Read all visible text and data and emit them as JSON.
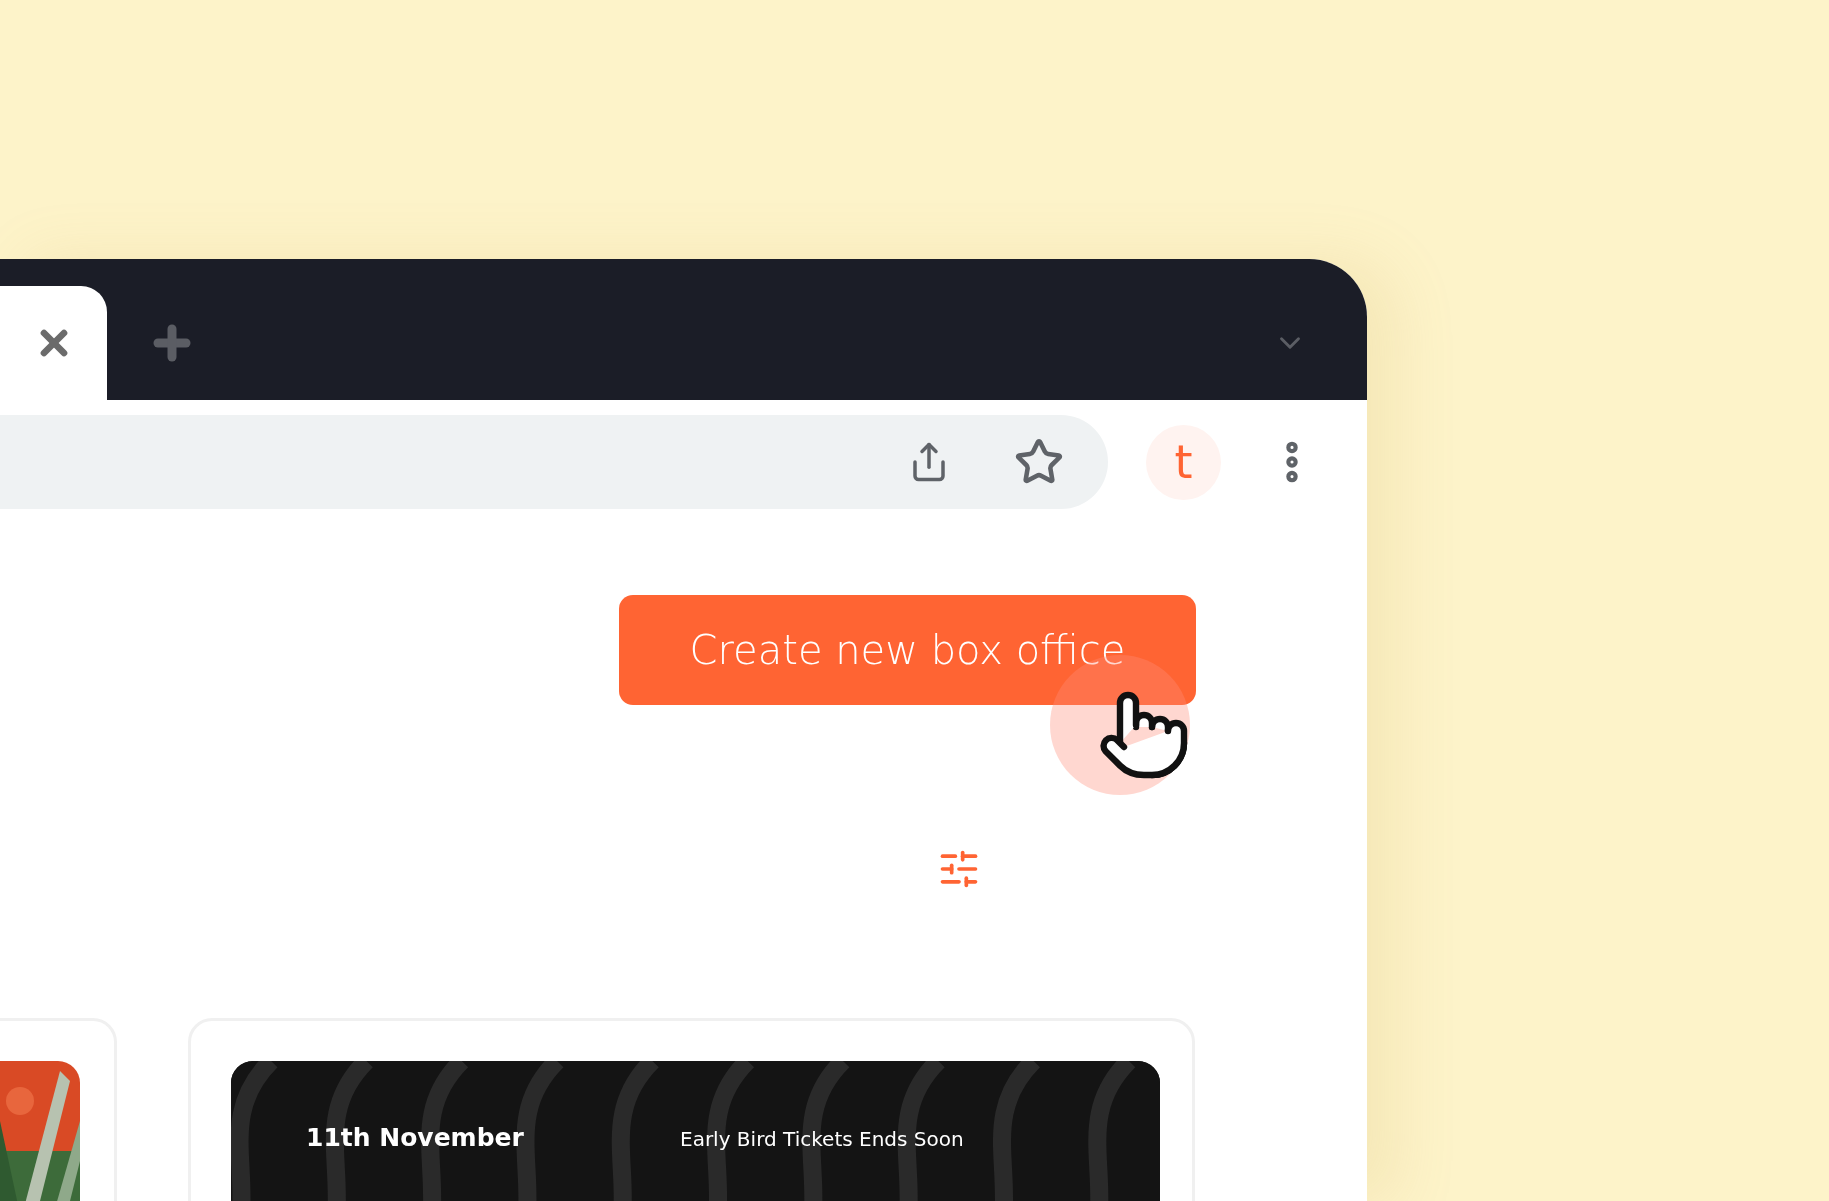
{
  "browser": {
    "profile_initial": "t"
  },
  "page": {
    "primary_button": "Create new box office",
    "cards": [
      {
        "kind": "picture"
      },
      {
        "kind": "event",
        "date": "11th November",
        "note": "Early Bird Tickets Ends Soon"
      }
    ]
  }
}
